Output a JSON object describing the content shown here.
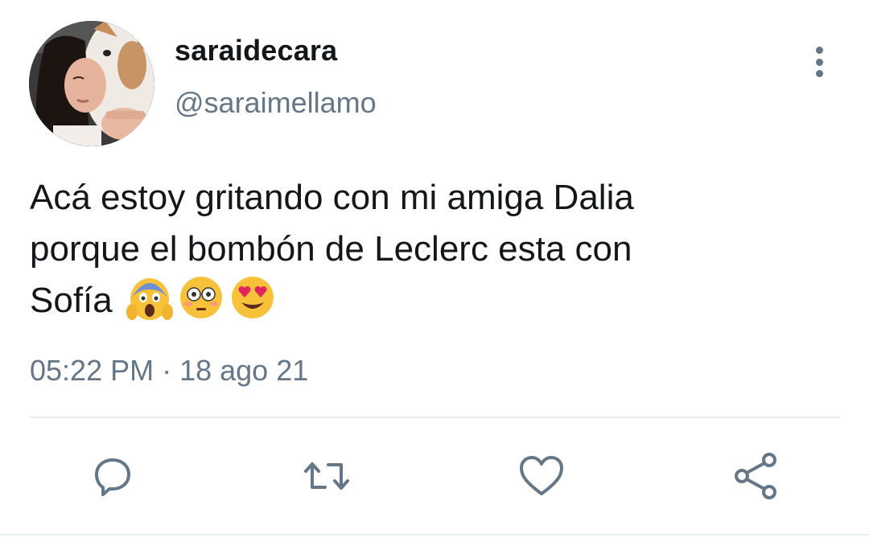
{
  "user": {
    "display_name": "saraidecara",
    "handle": "@saraimellamo"
  },
  "tweet": {
    "lines": [
      "Acá estoy gritando con mi amiga Dalia",
      "porque el bombón de Leclerc esta con",
      "Sofía"
    ],
    "emojis": [
      "face-screaming-in-fear",
      "flushed-face",
      "smiling-face-with-heart-eyes"
    ],
    "timestamp": "05:22 PM · 18 ago 21"
  },
  "actions": [
    "reply-icon",
    "retweet-icon",
    "like-icon",
    "share-icon"
  ],
  "colors": {
    "text": "#14171a",
    "secondary": "#657786",
    "divider": "#e6ecf0",
    "emoji_yellow": "#f7c23a"
  }
}
